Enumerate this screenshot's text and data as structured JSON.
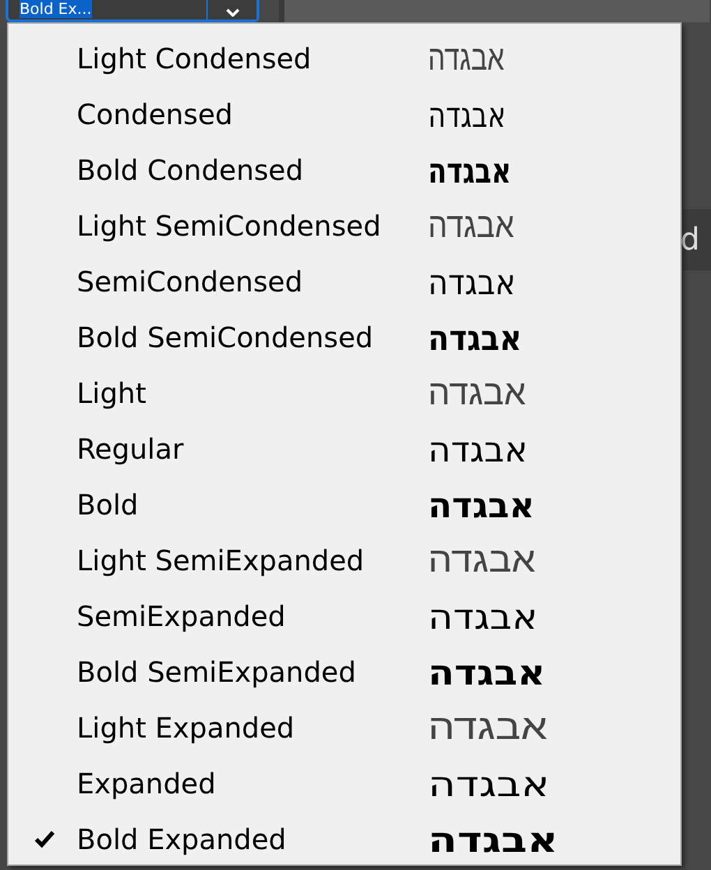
{
  "combo": {
    "value": "Bold Ex..."
  },
  "background_text": "d",
  "menu": {
    "items": [
      {
        "label": "Light Condensed",
        "sample": "אבגדה",
        "kind": "light-condensed",
        "selected": false
      },
      {
        "label": "Condensed",
        "sample": "אבגדה",
        "kind": "regular-condensed",
        "selected": false
      },
      {
        "label": "Bold Condensed",
        "sample": "אבגדה",
        "kind": "bold-condensed",
        "selected": false
      },
      {
        "label": "Light SemiCondensed",
        "sample": "אבגדה",
        "kind": "light-semicondensed",
        "selected": false
      },
      {
        "label": "SemiCondensed",
        "sample": "אבגדה",
        "kind": "regular-semicondensed",
        "selected": false
      },
      {
        "label": "Bold SemiCondensed",
        "sample": "אבגדה",
        "kind": "bold-semicondensed",
        "selected": false
      },
      {
        "label": "Light",
        "sample": "אבגדה",
        "kind": "light-normal",
        "selected": false
      },
      {
        "label": "Regular",
        "sample": "אבגדה",
        "kind": "regular-normal",
        "selected": false
      },
      {
        "label": "Bold",
        "sample": "אבגדה",
        "kind": "bold-normal",
        "selected": false
      },
      {
        "label": "Light SemiExpanded",
        "sample": "אבגדה",
        "kind": "light-semiexpanded",
        "selected": false
      },
      {
        "label": "SemiExpanded",
        "sample": "אבגדה",
        "kind": "regular-semiexpanded",
        "selected": false
      },
      {
        "label": "Bold SemiExpanded",
        "sample": "אבגדה",
        "kind": "bold-semiexpanded",
        "selected": false
      },
      {
        "label": "Light Expanded",
        "sample": "אבגדה",
        "kind": "light-expanded",
        "selected": false
      },
      {
        "label": "Expanded",
        "sample": "אבגדה",
        "kind": "regular-expanded",
        "selected": false
      },
      {
        "label": "Bold Expanded",
        "sample": "אבגדה",
        "kind": "bold-expanded",
        "selected": true
      }
    ]
  }
}
